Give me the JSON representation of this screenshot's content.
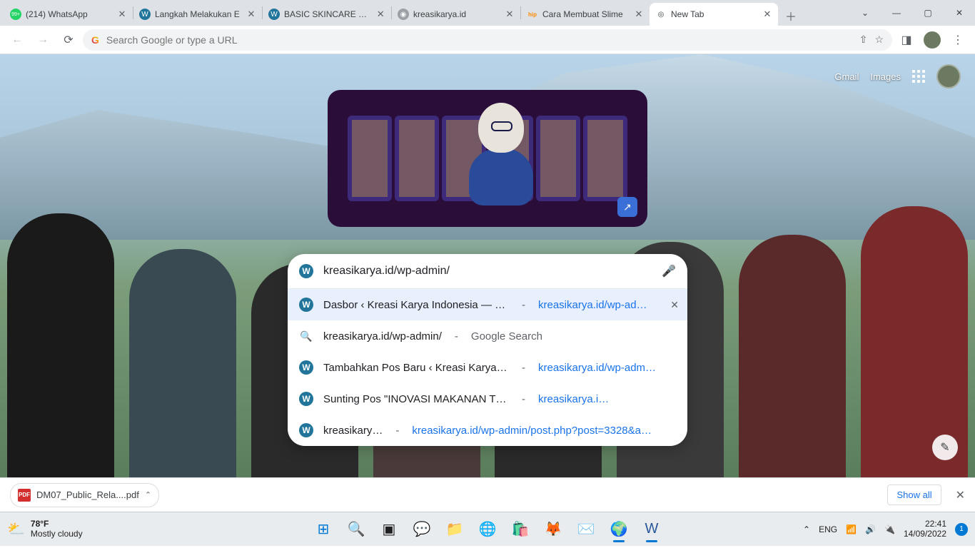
{
  "tabs": [
    {
      "title": "(214) WhatsApp",
      "favicon_bg": "#25d366",
      "favicon_text": "99+"
    },
    {
      "title": "Langkah Melakukan E",
      "favicon_bg": "#21759b",
      "favicon_text": "W"
    },
    {
      "title": "BASIC SKINCARE EMI",
      "favicon_bg": "#21759b",
      "favicon_text": "W"
    },
    {
      "title": "kreasikarya.id",
      "favicon_bg": "#9aa0a6",
      "favicon_text": "◉"
    },
    {
      "title": "Cara Membuat Slime",
      "favicon_bg": "#ff8a00",
      "favicon_text": "hip"
    },
    {
      "title": "New Tab",
      "favicon_bg": "#f1f3f4",
      "favicon_text": "◎",
      "active": true
    }
  ],
  "omnibox": {
    "placeholder": "Search Google or type a URL"
  },
  "topright": {
    "gmail": "Gmail",
    "images": "Images"
  },
  "search": {
    "query": "kreasikarya.id/wp-admin/",
    "suggestions": [
      {
        "icon": "wp",
        "t1": "Dasbor ‹ Kreasi Karya Indonesia — Wor…",
        "dash": " - ",
        "t2": "kreasikarya.id/wp-ad…",
        "selected": true,
        "removable": true
      },
      {
        "icon": "search",
        "t1": "kreasikarya.id/wp-admin/",
        "dash": " - ",
        "t2grey": "Google Search"
      },
      {
        "icon": "wp",
        "t1": "Tambahkan Pos Baru ‹ Kreasi Karya …",
        "dash": " - ",
        "t2": "kreasikarya.id/wp-adm…"
      },
      {
        "icon": "wp",
        "t1": "Sunting Pos \"INOVASI MAKANAN TRADISION…",
        "dash": "  - ",
        "t2": "kreasikarya.i…"
      },
      {
        "icon": "wp",
        "t1": "kreasikary…",
        "dash": " - ",
        "t2": "kreasikarya.id/wp-admin/post.php?post=3328&a…"
      }
    ]
  },
  "downloads": {
    "file": "DM07_Public_Rela....pdf",
    "showall": "Show all",
    "pdf_label": "PDF"
  },
  "taskbar": {
    "temp": "78°F",
    "cond": "Mostly cloudy",
    "lang": "ENG",
    "time": "22:41",
    "date": "14/09/2022",
    "notif_count": "1"
  }
}
